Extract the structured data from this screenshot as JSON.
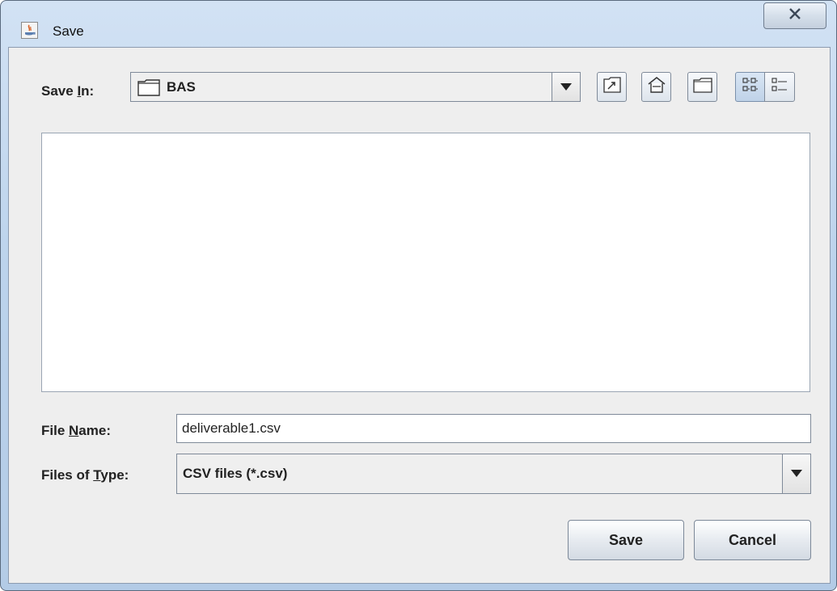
{
  "window": {
    "title": "Save"
  },
  "save_in": {
    "label_before": "Save ",
    "label_mnemonic": "I",
    "label_after": "n:",
    "value": "BAS"
  },
  "toolbar": {
    "buttons": [
      {
        "name": "up-one-level",
        "icon": "folder-up-icon"
      },
      {
        "name": "home",
        "icon": "home-icon"
      },
      {
        "name": "create-new-folder",
        "icon": "new-folder-icon"
      },
      {
        "name": "list-view",
        "icon": "list-view-icon",
        "selected": true
      },
      {
        "name": "details-view",
        "icon": "details-view-icon",
        "selected": false
      }
    ]
  },
  "file_name": {
    "label_before": "File ",
    "label_mnemonic": "N",
    "label_after": "ame:",
    "value": "deliverable1.csv"
  },
  "file_type": {
    "label_before": "Files of ",
    "label_mnemonic": "T",
    "label_after": "ype:",
    "value": "CSV files (*.csv)"
  },
  "buttons": {
    "save": "Save",
    "cancel": "Cancel"
  },
  "colors": {
    "title_bar": "#bcd3ec",
    "client_bg": "#eeeeee",
    "selected_toggle": "#c9dbef"
  }
}
